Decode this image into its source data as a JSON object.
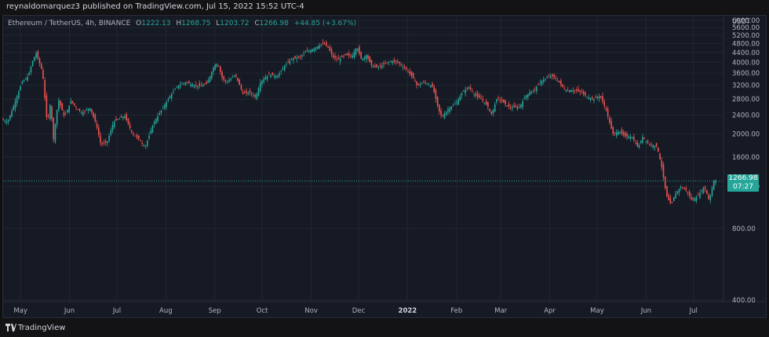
{
  "header": {
    "publish_text": "reynaldomarquez3 published on TradingView.com, Jul 15, 2022 15:52 UTC-4"
  },
  "legend": {
    "symbol": "Ethereum / TetherUS, 4h, BINANCE",
    "open_label": "O",
    "open": "1222.13",
    "high_label": "H",
    "high": "1268.75",
    "low_label": "L",
    "low": "1203.72",
    "close_label": "C",
    "close": "1266.98",
    "change": "+44.85 (+3.67%)"
  },
  "price_label": {
    "price": "1266.98",
    "countdown": "07:27"
  },
  "footer": {
    "brand": "TradingView"
  },
  "colors": {
    "up": "#26a69a",
    "down": "#ef5350",
    "background": "#161a25",
    "grid": "#22262f",
    "axis_text": "#b2b5be"
  },
  "chart_data": {
    "type": "line",
    "style": "candlestick",
    "title": "Ethereum / TetherUS, 4h, BINANCE",
    "currency": "USDT",
    "y_scale": "log",
    "ylim": [
      400,
      6000
    ],
    "yticks": [
      400,
      800,
      1200,
      1600,
      2000,
      2400,
      2800,
      3200,
      3600,
      4000,
      4400,
      4800,
      5200,
      5600,
      6000
    ],
    "ytick_labels": [
      "400.00",
      "800.00",
      "1200.00",
      "1600.00",
      "2000.00",
      "2400.00",
      "2800.00",
      "3200.00",
      "3600.00",
      "4000.00",
      "4400.00",
      "4800.00",
      "5200.00",
      "5600.00",
      "6000.00"
    ],
    "x_tick_labels": [
      "May",
      "Jun",
      "Jul",
      "Aug",
      "Sep",
      "Oct",
      "Nov",
      "Dec",
      "2022",
      "Feb",
      "Mar",
      "Apr",
      "May",
      "Jun",
      "Jul"
    ],
    "x_tick_dates": [
      "2021-05-01",
      "2021-06-01",
      "2021-07-01",
      "2021-08-01",
      "2021-09-01",
      "2021-10-01",
      "2021-11-01",
      "2021-12-01",
      "2022-01-01",
      "2022-02-01",
      "2022-03-01",
      "2022-04-01",
      "2022-05-01",
      "2022-06-01",
      "2022-07-01"
    ],
    "xlim": [
      "2021-04-20",
      "2022-07-20"
    ],
    "last_price": 1266.98,
    "series": [
      {
        "values": [
          [
            "2021-04-20",
            2300
          ],
          [
            "2021-04-24",
            2250
          ],
          [
            "2021-04-28",
            2650
          ],
          [
            "2021-05-03",
            3300
          ],
          [
            "2021-05-07",
            3500
          ],
          [
            "2021-05-10",
            4100
          ],
          [
            "2021-05-12",
            4360
          ],
          [
            "2021-05-16",
            3650
          ],
          [
            "2021-05-19",
            2200
          ],
          [
            "2021-05-21",
            2700
          ],
          [
            "2021-05-23",
            1900
          ],
          [
            "2021-05-26",
            2800
          ],
          [
            "2021-05-30",
            2350
          ],
          [
            "2021-06-03",
            2750
          ],
          [
            "2021-06-07",
            2550
          ],
          [
            "2021-06-10",
            2450
          ],
          [
            "2021-06-15",
            2580
          ],
          [
            "2021-06-19",
            2200
          ],
          [
            "2021-06-22",
            1800
          ],
          [
            "2021-06-26",
            1850
          ],
          [
            "2021-06-30",
            2250
          ],
          [
            "2021-07-07",
            2380
          ],
          [
            "2021-07-12",
            2000
          ],
          [
            "2021-07-16",
            1900
          ],
          [
            "2021-07-20",
            1760
          ],
          [
            "2021-07-25",
            2200
          ],
          [
            "2021-07-30",
            2500
          ],
          [
            "2021-08-05",
            2900
          ],
          [
            "2021-08-10",
            3200
          ],
          [
            "2021-08-15",
            3300
          ],
          [
            "2021-08-20",
            3200
          ],
          [
            "2021-08-24",
            3180
          ],
          [
            "2021-08-28",
            3250
          ],
          [
            "2021-09-02",
            3900
          ],
          [
            "2021-09-04",
            3950
          ],
          [
            "2021-09-07",
            3400
          ],
          [
            "2021-09-10",
            3300
          ],
          [
            "2021-09-15",
            3550
          ],
          [
            "2021-09-20",
            2950
          ],
          [
            "2021-09-24",
            3000
          ],
          [
            "2021-09-28",
            2850
          ],
          [
            "2021-10-01",
            3300
          ],
          [
            "2021-10-06",
            3550
          ],
          [
            "2021-10-12",
            3500
          ],
          [
            "2021-10-16",
            3850
          ],
          [
            "2021-10-21",
            4150
          ],
          [
            "2021-10-26",
            4200
          ],
          [
            "2021-10-29",
            4400
          ],
          [
            "2021-11-02",
            4500
          ],
          [
            "2021-11-08",
            4750
          ],
          [
            "2021-11-10",
            4800
          ],
          [
            "2021-11-13",
            4600
          ],
          [
            "2021-11-16",
            4200
          ],
          [
            "2021-11-19",
            4100
          ],
          [
            "2021-11-24",
            4300
          ],
          [
            "2021-11-28",
            4250
          ],
          [
            "2021-12-01",
            4650
          ],
          [
            "2021-12-04",
            4100
          ],
          [
            "2021-12-07",
            4300
          ],
          [
            "2021-12-10",
            3900
          ],
          [
            "2021-12-14",
            3800
          ],
          [
            "2021-12-19",
            3950
          ],
          [
            "2021-12-23",
            4050
          ],
          [
            "2021-12-27",
            4000
          ],
          [
            "2022-01-01",
            3750
          ],
          [
            "2022-01-05",
            3500
          ],
          [
            "2022-01-08",
            3200
          ],
          [
            "2022-01-13",
            3300
          ],
          [
            "2022-01-18",
            3150
          ],
          [
            "2022-01-22",
            2500
          ],
          [
            "2022-01-24",
            2350
          ],
          [
            "2022-01-28",
            2550
          ],
          [
            "2022-02-02",
            2700
          ],
          [
            "2022-02-06",
            3000
          ],
          [
            "2022-02-10",
            3150
          ],
          [
            "2022-02-14",
            2900
          ],
          [
            "2022-02-18",
            2800
          ],
          [
            "2022-02-22",
            2600
          ],
          [
            "2022-02-24",
            2400
          ],
          [
            "2022-02-28",
            2850
          ],
          [
            "2022-03-04",
            2700
          ],
          [
            "2022-03-08",
            2580
          ],
          [
            "2022-03-14",
            2600
          ],
          [
            "2022-03-18",
            2900
          ],
          [
            "2022-03-24",
            3100
          ],
          [
            "2022-03-28",
            3350
          ],
          [
            "2022-04-02",
            3480
          ],
          [
            "2022-04-04",
            3500
          ],
          [
            "2022-04-08",
            3300
          ],
          [
            "2022-04-12",
            3050
          ],
          [
            "2022-04-18",
            3050
          ],
          [
            "2022-04-22",
            3000
          ],
          [
            "2022-04-26",
            2850
          ],
          [
            "2022-04-30",
            2800
          ],
          [
            "2022-05-04",
            2900
          ],
          [
            "2022-05-08",
            2500
          ],
          [
            "2022-05-12",
            2000
          ],
          [
            "2022-05-16",
            2050
          ],
          [
            "2022-05-20",
            1950
          ],
          [
            "2022-05-24",
            1950
          ],
          [
            "2022-05-28",
            1750
          ],
          [
            "2022-05-31",
            1950
          ],
          [
            "2022-06-04",
            1800
          ],
          [
            "2022-06-09",
            1780
          ],
          [
            "2022-06-12",
            1450
          ],
          [
            "2022-06-15",
            1100
          ],
          [
            "2022-06-18",
            1000
          ],
          [
            "2022-06-20",
            1100
          ],
          [
            "2022-06-24",
            1200
          ],
          [
            "2022-06-28",
            1150
          ],
          [
            "2022-07-01",
            1050
          ],
          [
            "2022-07-05",
            1100
          ],
          [
            "2022-07-09",
            1200
          ],
          [
            "2022-07-12",
            1050
          ],
          [
            "2022-07-15",
            1266.98
          ]
        ]
      }
    ]
  }
}
